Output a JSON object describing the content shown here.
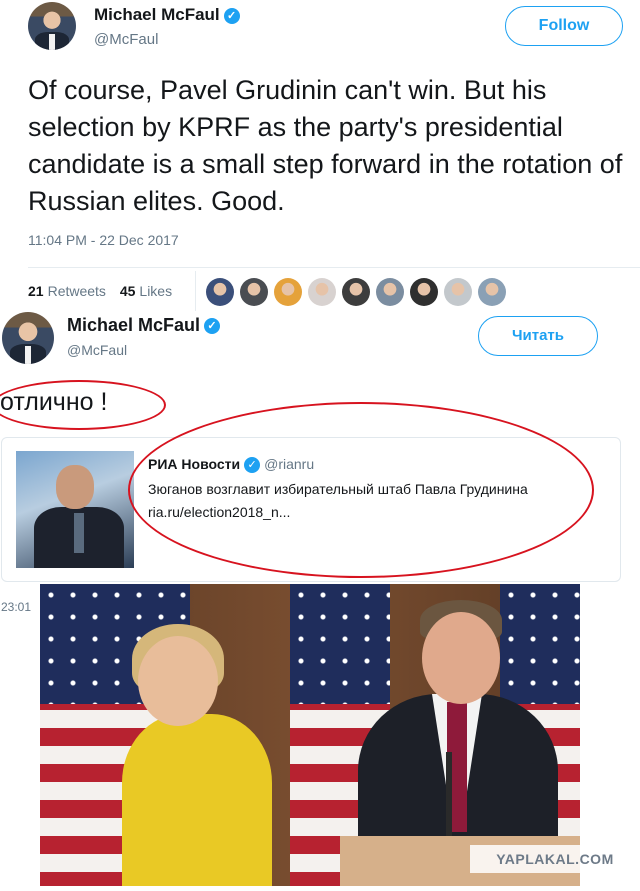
{
  "tweet1": {
    "author_name": "Michael McFaul",
    "author_handle": "@McFaul",
    "follow_label": "Follow",
    "text": "Of course, Pavel Grudinin can't win. But his selection by KPRF as the party's presidential candidate is a small step forward in the rotation of Russian elites.  Good.",
    "timestamp": "11:04 PM - 22 Dec 2017",
    "retweets_count": "21",
    "retweets_label": "Retweets",
    "likes_count": "45",
    "likes_label": "Likes",
    "liker_avatar_colors": [
      "#3b4f7a",
      "#4a4d52",
      "#e5a23b",
      "#d8d2d0",
      "#3d3d3d",
      "#7b8da0",
      "#2f2f2f",
      "#c3c8cc",
      "#8aa0b5"
    ]
  },
  "tweet2": {
    "author_name": "Michael McFaul",
    "author_handle": "@McFaul",
    "follow_label": "Читать",
    "text": "отлично !",
    "quote_source_name": "РИА Новости",
    "quote_source_handle": "@rianru",
    "quote_title": "Зюганов возглавит избирательный штаб Павла Грудинина",
    "quote_link": "ria.ru/election2018_n...",
    "timestamp": "23:01"
  },
  "watermark": "YAPLAKAL.COM",
  "colors": {
    "twitter_blue": "#1da1f2",
    "secondary_text": "#657786",
    "annotation_red": "#d7131f"
  }
}
